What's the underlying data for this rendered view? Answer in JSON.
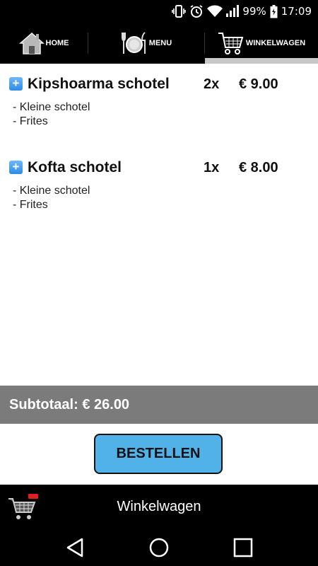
{
  "status_bar": {
    "battery_percent": "99%",
    "time": "17:09",
    "icons": [
      "vibrate-icon",
      "alarm-icon",
      "wifi-icon",
      "signal-icon",
      "battery-icon"
    ]
  },
  "tabs": [
    {
      "label": "HOME",
      "icon": "house-icon"
    },
    {
      "label": "MENU",
      "icon": "plate-cutlery-icon"
    },
    {
      "label": "WINKELWAGEN",
      "icon": "shopping-cart-icon",
      "selected": true
    }
  ],
  "cart": {
    "items": [
      {
        "name": "Kipshoarma schotel",
        "qty": "2x",
        "price": "€ 9.00",
        "options": [
          "- Kleine schotel",
          "- Frites"
        ]
      },
      {
        "name": "Kofta schotel",
        "qty": "1x",
        "price": "€ 8.00",
        "options": [
          "- Kleine schotel",
          "- Frites"
        ]
      }
    ],
    "expand_icon": "+",
    "subtotal": "Subtotaal: € 26.00",
    "order_button": "BESTELLEN"
  },
  "bottom_bar": {
    "title": "Winkelwagen",
    "icon": "cart-badge-icon"
  },
  "nav": {
    "icons": [
      "back-icon",
      "home-circle-icon",
      "recents-square-icon"
    ]
  },
  "colors": {
    "accent": "#50b2e8",
    "subtotal_bg": "#7b7b7b",
    "bar_bg": "#000000",
    "tab_indicator": "#c8c8c8"
  }
}
